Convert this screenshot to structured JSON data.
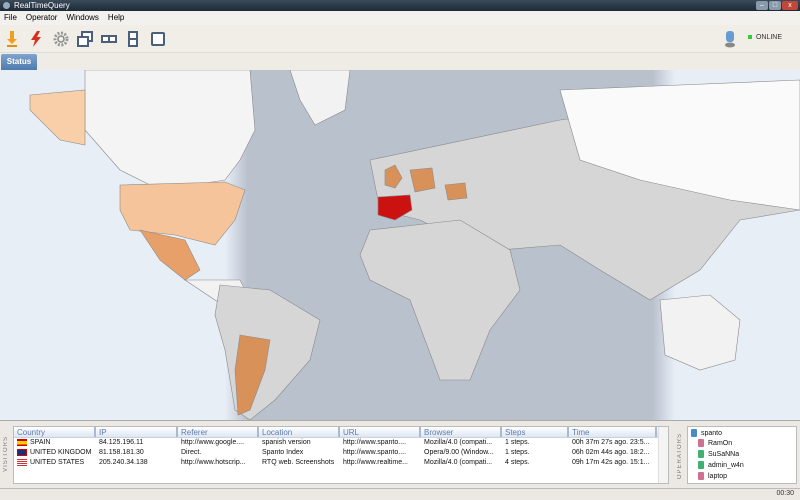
{
  "window": {
    "title": "RealTimeQuery"
  },
  "menu": [
    "File",
    "Operator",
    "Windows",
    "Help"
  ],
  "toolbar": {
    "status": "ONLINE"
  },
  "tabs": [
    "Status"
  ],
  "map": {
    "highlighted_countries": [
      {
        "name": "Spain",
        "color": "#cc1111"
      },
      {
        "name": "United Kingdom",
        "color": "#d9915a"
      },
      {
        "name": "United States",
        "color": "#f6c49a"
      },
      {
        "name": "Canada",
        "color": "#f8cfa8"
      },
      {
        "name": "Mexico",
        "color": "#e8a06a"
      },
      {
        "name": "Argentina",
        "color": "#d9915a"
      },
      {
        "name": "Germany",
        "color": "#d9915a"
      },
      {
        "name": "Romania",
        "color": "#d9915a"
      }
    ]
  },
  "visitors": {
    "label": "VISITORS",
    "columns": [
      "Country",
      "IP",
      "Referer",
      "Location",
      "URL",
      "Browser",
      "Steps",
      "Time"
    ],
    "rows": [
      [
        "SPAIN",
        "84.125.196.11",
        "http://www.google....",
        "spanish version",
        "http://www.spanto....",
        "Mozilla/4.0 (compati...",
        "1 steps.",
        "00h 37m 27s ago. 23:5..."
      ],
      [
        "UNITED KINGDOM",
        "81.158.181.30",
        "Direct.",
        "Spanto Index",
        "http://www.spanto....",
        "Opera/9.00 (Window...",
        "1 steps.",
        "06h 02m 44s ago. 18:2..."
      ],
      [
        "UNITED STATES",
        "205.240.34.138",
        "http://www.hotscrip...",
        "RTQ web. Screenshots",
        "http://www.realtime...",
        "Mozilla/4.0 (compati...",
        "4 steps.",
        "09h 17m 42s ago. 15:1..."
      ]
    ]
  },
  "operators": {
    "label": "OPERATORS",
    "items": [
      "spanto",
      "RamOn",
      "SuSaNNa",
      "admin_w4n",
      "laptop"
    ]
  },
  "statusbar": {
    "clock": "00:30"
  }
}
